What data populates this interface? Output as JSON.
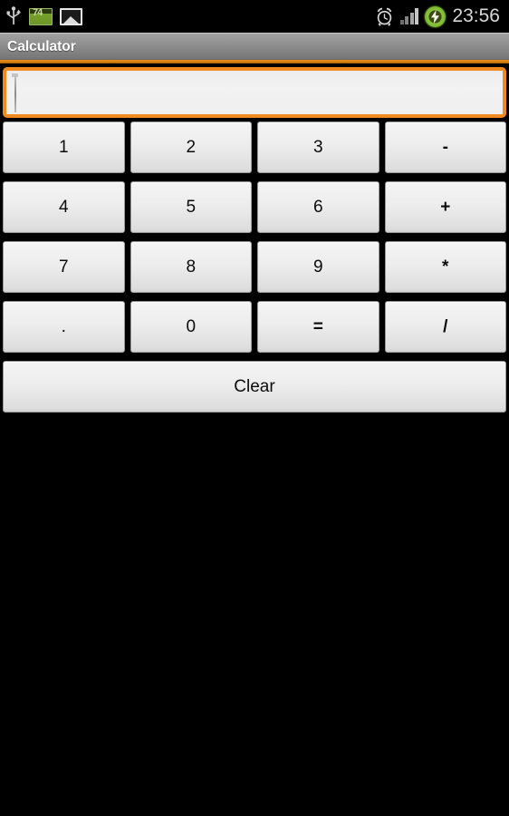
{
  "status_bar": {
    "left_icons": [
      {
        "name": "usb-icon",
        "label": "USB connected"
      },
      {
        "name": "screen-capture-icon",
        "label": "74"
      },
      {
        "name": "gallery-image-icon",
        "label": "Image saved"
      }
    ],
    "right_icons": [
      {
        "name": "alarm-clock-icon",
        "label": "Alarm set"
      },
      {
        "name": "signal-bars-icon",
        "label": "Signal"
      },
      {
        "name": "battery-charging-icon",
        "label": "Charging"
      }
    ],
    "clock": "23:56",
    "capture_badge": "74"
  },
  "title_bar": {
    "title": "Calculator"
  },
  "display": {
    "value": "",
    "placeholder": ""
  },
  "keypad": {
    "rows": [
      [
        {
          "label": "1",
          "name": "key-1",
          "type": "digit"
        },
        {
          "label": "2",
          "name": "key-2",
          "type": "digit"
        },
        {
          "label": "3",
          "name": "key-3",
          "type": "digit"
        },
        {
          "label": "-",
          "name": "key-minus",
          "type": "operator"
        }
      ],
      [
        {
          "label": "4",
          "name": "key-4",
          "type": "digit"
        },
        {
          "label": "5",
          "name": "key-5",
          "type": "digit"
        },
        {
          "label": "6",
          "name": "key-6",
          "type": "digit"
        },
        {
          "label": "+",
          "name": "key-plus",
          "type": "operator"
        }
      ],
      [
        {
          "label": "7",
          "name": "key-7",
          "type": "digit"
        },
        {
          "label": "8",
          "name": "key-8",
          "type": "digit"
        },
        {
          "label": "9",
          "name": "key-9",
          "type": "digit"
        },
        {
          "label": "*",
          "name": "key-multiply",
          "type": "operator"
        }
      ],
      [
        {
          "label": ".",
          "name": "key-decimal",
          "type": "digit"
        },
        {
          "label": "0",
          "name": "key-0",
          "type": "digit"
        },
        {
          "label": "=",
          "name": "key-equals",
          "type": "operator"
        },
        {
          "label": "/",
          "name": "key-divide",
          "type": "operator"
        }
      ]
    ],
    "clear_label": "Clear"
  },
  "colors": {
    "accent_orange": "#f08a1e",
    "title_bar_gray": "#8e8e8e",
    "background": "#000000",
    "key_face": "#ededed",
    "battery_green": "#8ec63f"
  }
}
